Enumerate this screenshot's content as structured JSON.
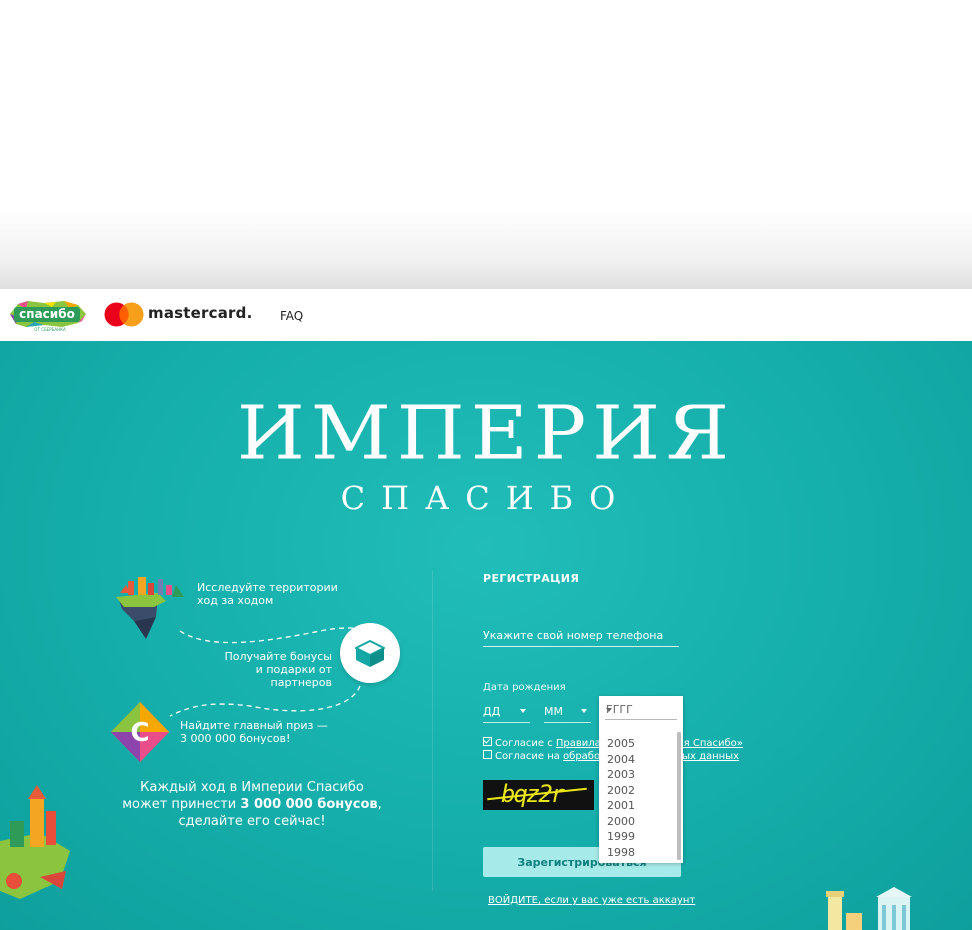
{
  "header": {
    "spasibo_logo_text": "спасибо",
    "spasibo_logo_subtext": "ОТ СБЕРБАНКА",
    "mastercard_text": "mastercard.",
    "faq_label": "FAQ"
  },
  "hero": {
    "title": "ИМПЕРИЯ",
    "subtitle": "СПАСИБО"
  },
  "features": [
    {
      "line1": "Исследуйте территории",
      "line2": "ход за ходом",
      "icon": "island-icon"
    },
    {
      "line1": "Получайте бонусы",
      "line2": "и подарки от партнеров",
      "icon": "box-icon"
    },
    {
      "line1": "Найдите главный приз —",
      "line2": "3 000 000  бонусов!",
      "icon": "spasibo-c-icon"
    }
  ],
  "tagline": {
    "line1": "Каждый ход в Империи Спасибо",
    "line2_pre": "может принести ",
    "line2_bold": "3 000 000 бонусов",
    "line2_post": ",",
    "line3": "сделайте его сейчас!"
  },
  "registration": {
    "title": "РЕГИСТРАЦИЯ",
    "phone_placeholder": "Укажите свой номер телефона",
    "dob_label": "Дата рождения",
    "day_placeholder": "ДД",
    "month_placeholder": "ММ",
    "year_placeholder": "ГГГГ",
    "year_options": [
      "2005",
      "2004",
      "2003",
      "2002",
      "2001",
      "2000",
      "1999",
      "1998"
    ],
    "consent1_prefix": "Согласие с ",
    "consent1_link_start": "Правила",
    "consent1_link_end": "рия Спасибо»",
    "consent1_checked": true,
    "consent2_prefix": "Согласие на ",
    "consent2_link_start": "обрабо",
    "consent2_link_end": "ых данных",
    "consent2_checked": false,
    "captcha_text": "bqz2r",
    "submit_visible_start": "Зарегистриро",
    "submit_visible_end": "ваться",
    "login_link": "ВОЙДИТЕ, если у вас уже есть аккаунт"
  },
  "colors": {
    "teal": "#15aeaa",
    "button_bg": "#a6ebe9",
    "button_text": "#10807e",
    "mc_red": "#eb001b",
    "mc_yellow": "#f79e1b"
  }
}
